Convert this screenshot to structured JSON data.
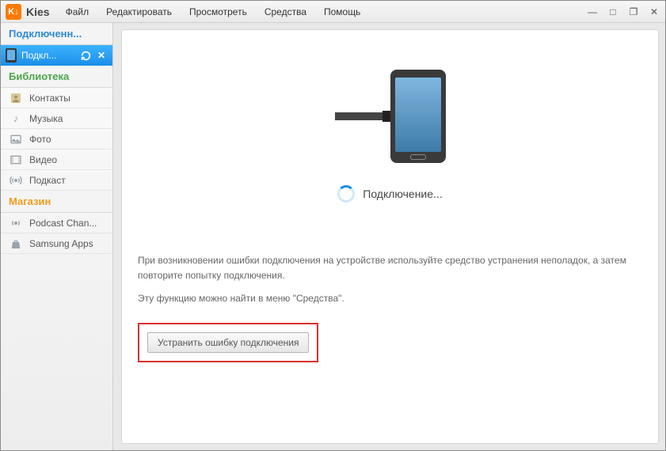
{
  "app": {
    "title": "Kies",
    "icon_label": "K↓"
  },
  "menu": {
    "file": "Файл",
    "edit": "Редактировать",
    "view": "Просмотреть",
    "tools": "Средства",
    "help": "Помощь"
  },
  "sidebar": {
    "section_connected": "Подключенн...",
    "device_label": "Подкл...",
    "section_library": "Библиотека",
    "items": [
      {
        "label": "Контакты"
      },
      {
        "label": "Музыка"
      },
      {
        "label": "Фото"
      },
      {
        "label": "Видео"
      },
      {
        "label": "Подкаст"
      }
    ],
    "section_store": "Магазин",
    "store_items": [
      {
        "label": "Podcast Chan..."
      },
      {
        "label": "Samsung Apps"
      }
    ]
  },
  "main": {
    "connecting_label": "Подключение...",
    "help_line1": "При возникновении ошибки подключения на устройстве используйте средство устранения неполадок, а затем повторите попытку подключения.",
    "help_line2": "Эту функцию можно найти в меню \"Средства\".",
    "fix_button": "Устранить ошибку подключения"
  }
}
